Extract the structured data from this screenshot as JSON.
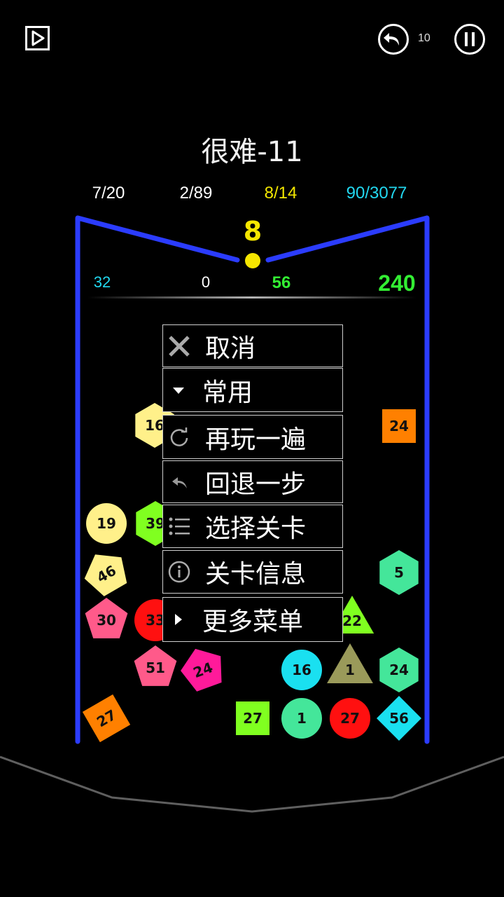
{
  "level_title": "很难-11",
  "hud": {
    "undo_count": "10"
  },
  "stats": [
    {
      "text": "7/20",
      "color": "#ffffff"
    },
    {
      "text": "2/89",
      "color": "#ffffff"
    },
    {
      "text": "8/14",
      "color": "#f2e600"
    },
    {
      "text": "90/3077",
      "color": "#22d8f0"
    }
  ],
  "ball_count": "8",
  "scores": [
    {
      "text": "32",
      "color": "#22d8f0"
    },
    {
      "text": "0",
      "color": "#ffffff"
    },
    {
      "text": "56",
      "color": "#33ee33"
    },
    {
      "text": "240",
      "color": "#33ee33"
    }
  ],
  "menu": {
    "cancel": "取消",
    "common": "常用",
    "replay": "再玩一遍",
    "undo_step": "回退一步",
    "select_level": "选择关卡",
    "level_info": "关卡信息",
    "more_menu": "更多菜单"
  },
  "blocks": [
    {
      "shape": "hexagon",
      "label": "16",
      "color": "#fff08a"
    },
    {
      "shape": "square",
      "label": "24",
      "color": "#ff8000"
    },
    {
      "shape": "circle",
      "label": "19",
      "color": "#fff08a"
    },
    {
      "shape": "hexagon",
      "label": "39",
      "color": "#80ff20"
    },
    {
      "shape": "pentagon",
      "label": "46",
      "color": "#fff08a"
    },
    {
      "shape": "hexagon",
      "label": "5",
      "color": "#44e69a"
    },
    {
      "shape": "pentagon",
      "label": "30",
      "color": "#ff5a8a"
    },
    {
      "shape": "circle",
      "label": "33",
      "color": "#ff1010"
    },
    {
      "shape": "triangle",
      "label": "22",
      "color": "#80ff20"
    },
    {
      "shape": "pentagon",
      "label": "51",
      "color": "#ff5a8a"
    },
    {
      "shape": "pentagon",
      "label": "24",
      "color": "#ff1a9a"
    },
    {
      "shape": "circle",
      "label": "16",
      "color": "#1ae0f0"
    },
    {
      "shape": "triangle",
      "label": "1",
      "color": "#9a9a5a"
    },
    {
      "shape": "hexagon",
      "label": "24",
      "color": "#44e69a"
    },
    {
      "shape": "square",
      "label": "27",
      "color": "#ff8000"
    },
    {
      "shape": "square",
      "label": "27",
      "color": "#80ff20"
    },
    {
      "shape": "circle",
      "label": "1",
      "color": "#44e69a"
    },
    {
      "shape": "circle",
      "label": "27",
      "color": "#ff1010"
    },
    {
      "shape": "diamond",
      "label": "56",
      "color": "#1ae0f0"
    }
  ],
  "colors": {
    "wall": "#2b3cff",
    "ball": "#f5e600"
  }
}
